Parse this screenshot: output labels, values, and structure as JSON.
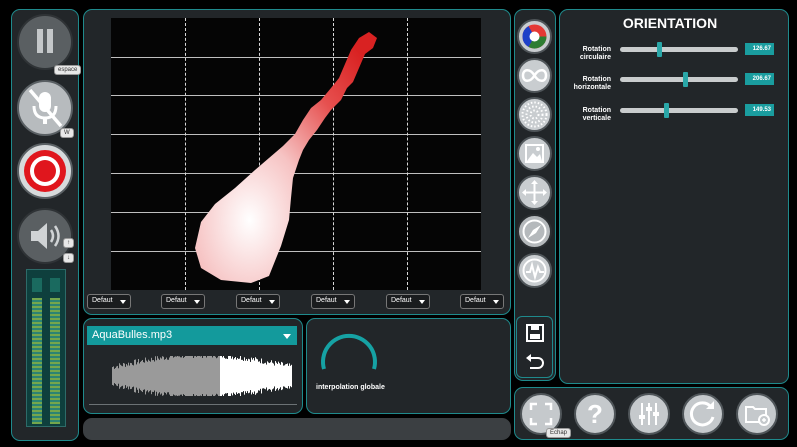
{
  "left_controls": {
    "pause_key_badge": "espace",
    "mic_key_badge": "W",
    "volume_up_badge": "↑",
    "volume_down_badge": "↓"
  },
  "drawing": {
    "dropdowns": [
      "Defaut",
      "Defaut",
      "Defaut",
      "Defaut",
      "Defaut",
      "Defaut"
    ]
  },
  "audio": {
    "track_name": "AquaBulles.mp3"
  },
  "interpolation": {
    "label": "interpolation globale"
  },
  "orientation": {
    "title": "ORIENTATION",
    "sliders": [
      {
        "label_line1": "Rotation",
        "label_line2": "circulaire",
        "value": "126.67",
        "fraction": 0.33
      },
      {
        "label_line1": "Rotation",
        "label_line2": "horizontale",
        "value": "206.67",
        "fraction": 0.55
      },
      {
        "label_line1": "Rotation",
        "label_line2": "verticale",
        "value": "149.53",
        "fraction": 0.39
      }
    ]
  },
  "bottom_bar": {
    "fullscreen_key_badge": "Echap"
  },
  "colors": {
    "accent": "#1a9d9f",
    "panel_bg": "#222629",
    "record_red": "#e0161d"
  },
  "icons": {
    "left": [
      "pause-icon",
      "microphone-muted-icon",
      "record-icon",
      "volume-icon"
    ],
    "side": [
      "color-wheel-icon",
      "infinity-icon",
      "dots-pattern-icon",
      "image-icon",
      "move-arrows-icon",
      "compass-icon",
      "waveform-icon",
      "save-icon",
      "undo-icon"
    ],
    "bottom": [
      "fullscreen-icon",
      "help-icon",
      "equalizer-icon",
      "refresh-icon",
      "open-folder-icon"
    ]
  }
}
